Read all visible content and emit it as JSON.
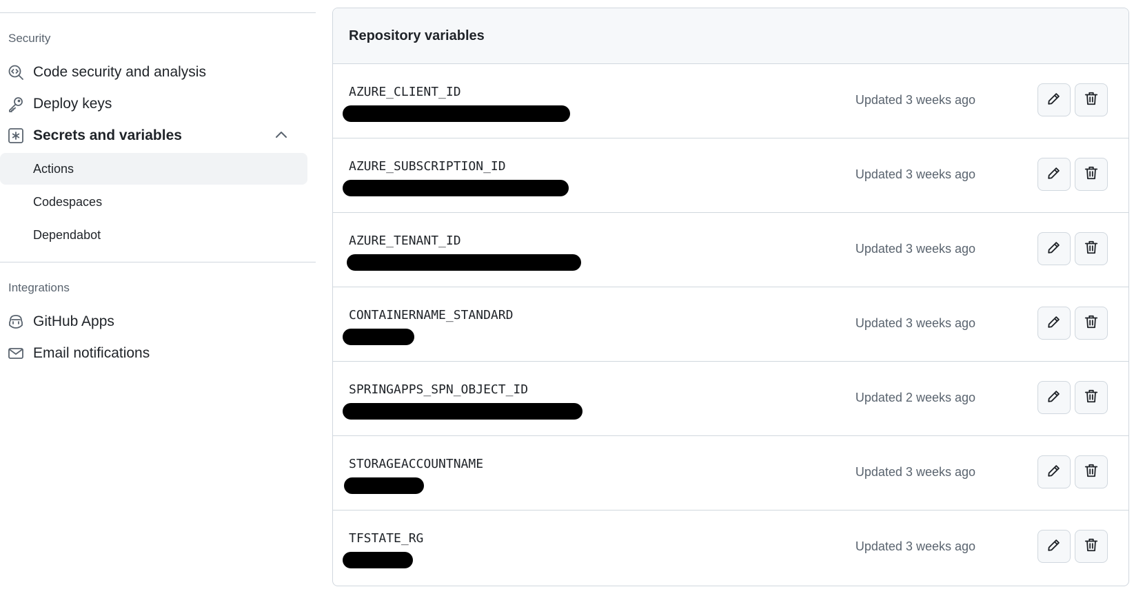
{
  "sidebar": {
    "security_heading": "Security",
    "integrations_heading": "Integrations",
    "items": [
      {
        "label": "Code security and analysis",
        "icon": "codescan-icon"
      },
      {
        "label": "Deploy keys",
        "icon": "key-icon"
      },
      {
        "label": "Secrets and variables",
        "icon": "key-asterisk-icon",
        "expanded": true
      },
      {
        "label": "GitHub Apps",
        "icon": "copilot-icon"
      },
      {
        "label": "Email notifications",
        "icon": "mail-icon"
      }
    ],
    "subitems": [
      {
        "label": "Actions",
        "active": true
      },
      {
        "label": "Codespaces",
        "active": false
      },
      {
        "label": "Dependabot",
        "active": false
      }
    ]
  },
  "panel": {
    "title": "Repository variables",
    "rows": [
      {
        "name": "AZURE_CLIENT_ID",
        "updated": "Updated 3 weeks ago"
      },
      {
        "name": "AZURE_SUBSCRIPTION_ID",
        "updated": "Updated 3 weeks ago"
      },
      {
        "name": "AZURE_TENANT_ID",
        "updated": "Updated 3 weeks ago"
      },
      {
        "name": "CONTAINERNAME_STANDARD",
        "updated": "Updated 3 weeks ago"
      },
      {
        "name": "SPRINGAPPS_SPN_OBJECT_ID",
        "updated": "Updated 2 weeks ago"
      },
      {
        "name": "STORAGEACCOUNTNAME",
        "updated": "Updated 3 weeks ago"
      },
      {
        "name": "TFSTATE_RG",
        "updated": "Updated 3 weeks ago"
      }
    ]
  }
}
